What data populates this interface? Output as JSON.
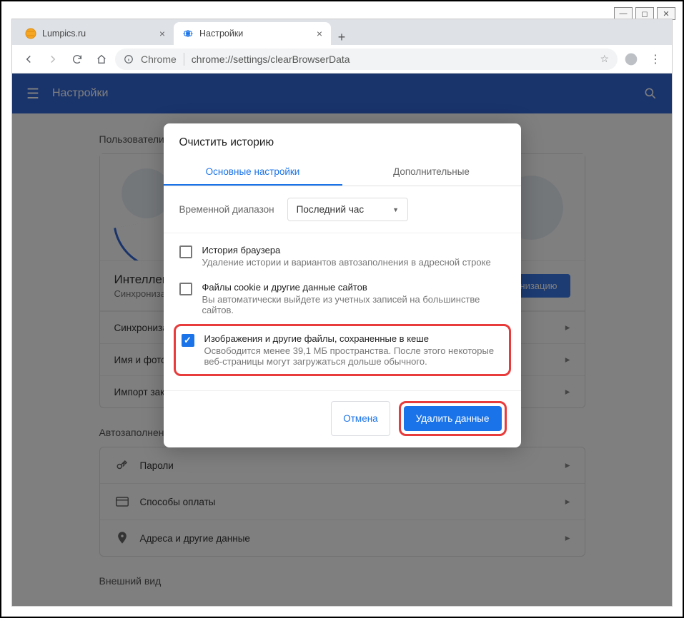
{
  "window": {
    "min": "—",
    "max": "◻",
    "close": "✕"
  },
  "tabs": {
    "t0": {
      "title": "Lumpics.ru"
    },
    "t1": {
      "title": "Настройки"
    },
    "newtab": "+"
  },
  "toolbar": {
    "label": "Chrome",
    "url": "chrome://settings/clearBrowserData"
  },
  "bluebar": {
    "title": "Настройки"
  },
  "sections": {
    "users": "Пользователи",
    "autofill": "Автозаполнение",
    "appearance": "Внешний вид"
  },
  "smart": {
    "title": "Интеллектуальные функции Google в Chrome",
    "sub": "Синхронизация и персонализация Chrome на всех устройствах",
    "btn": "Включить синхронизацию"
  },
  "rows": {
    "sync": "Синхронизация",
    "name": "Имя и фото",
    "import": "Импорт закладок и настроек",
    "pwd": "Пароли",
    "pay": "Способы оплаты",
    "addr": "Адреса и другие данные"
  },
  "dialog": {
    "title": "Очистить историю",
    "tab_basic": "Основные настройки",
    "tab_adv": "Дополнительные",
    "range_label": "Временной диапазон",
    "range_value": "Последний час",
    "opt1": {
      "title": "История браузера",
      "sub": "Удаление истории и вариантов автозаполнения в адресной строке"
    },
    "opt2": {
      "title": "Файлы cookie и другие данные сайтов",
      "sub": "Вы автоматически выйдете из учетных записей на большинстве сайтов."
    },
    "opt3": {
      "title": "Изображения и другие файлы, сохраненные в кеше",
      "sub": "Освободится менее 39,1 МБ пространства. После этого некоторые веб-страницы могут загружаться дольше обычного."
    },
    "cancel": "Отмена",
    "confirm": "Удалить данные"
  }
}
